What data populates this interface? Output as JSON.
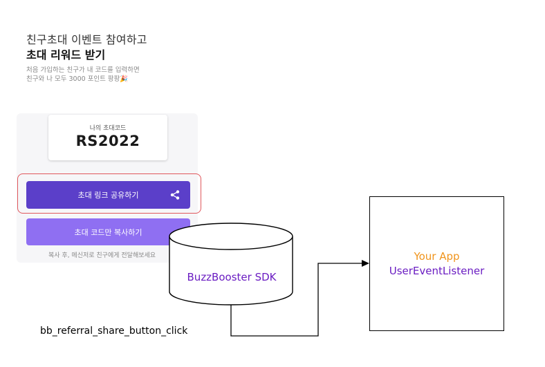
{
  "app_panel": {
    "title_line1": "친구초대 이벤트 참여하고",
    "title_line2": "초대 리워드 받기",
    "desc_line1": "처음 가입하는 친구가 내 코드를 입력하면",
    "desc_line2": "친구와 나 모두 3000 포인트 팡팡",
    "desc_emoji": "🎉",
    "code_label": "나의 초대코드",
    "code_value": "RS2022",
    "share_button_label": "초대 링크 공유하기",
    "copy_button_label": "초대 코드만 복사하기",
    "footnote": "복사 후, 메신저로 친구에게 전달해보세요"
  },
  "sdk": {
    "label": "BuzzBooster SDK"
  },
  "app_box": {
    "title": "Your App",
    "subtitle": "UserEventListener"
  },
  "event": {
    "label": "bb_referral_share_button_click"
  },
  "colors": {
    "share_button": "#5b3fc9",
    "copy_button": "#8f6ff2",
    "highlight": "#e0565b",
    "sdk_text": "#6a1cc2",
    "app_title": "#f0941c",
    "app_subtitle": "#6a1cc2"
  },
  "icons": {
    "share": "share-icon"
  }
}
